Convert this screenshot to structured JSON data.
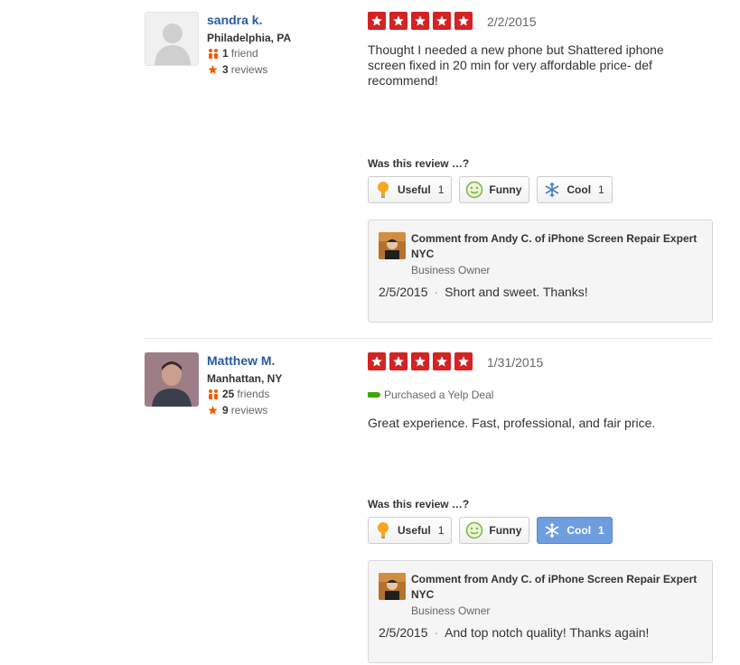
{
  "reviews": [
    {
      "user": {
        "name": "sandra k.",
        "location": "Philadelphia, PA",
        "friends_count": "1",
        "friends_label": "friend",
        "reviews_count": "3",
        "reviews_label": "reviews"
      },
      "rating": 5,
      "date": "2/2/2015",
      "text": "Thought I needed a new phone but Shattered iphone screen fixed in 20 min for very affordable price- def recommend!",
      "was_helpful_label": "Was this review …?",
      "votes": [
        {
          "label": "Useful",
          "count": "1",
          "icon": "lightbulb-icon",
          "active": false
        },
        {
          "label": "Funny",
          "count": "",
          "icon": "smiley-icon",
          "active": false
        },
        {
          "label": "Cool",
          "count": "1",
          "icon": "snowflake-icon",
          "active": false
        }
      ],
      "owner_comment": {
        "title": "Comment from Andy C. of iPhone Screen Repair Expert NYC",
        "role": "Business Owner",
        "date": "2/5/2015",
        "text": "Short and sweet. Thanks!"
      }
    },
    {
      "user": {
        "name": "Matthew M.",
        "location": "Manhattan, NY",
        "friends_count": "25",
        "friends_label": "friends",
        "reviews_count": "9",
        "reviews_label": "reviews"
      },
      "rating": 5,
      "date": "1/31/2015",
      "deal_label": "Purchased a Yelp Deal",
      "text": "Great experience.  Fast, professional, and fair price.",
      "was_helpful_label": "Was this review …?",
      "votes": [
        {
          "label": "Useful",
          "count": "1",
          "icon": "lightbulb-icon",
          "active": false
        },
        {
          "label": "Funny",
          "count": "",
          "icon": "smiley-icon",
          "active": false
        },
        {
          "label": "Cool",
          "count": "1",
          "icon": "snowflake-icon",
          "active": true
        }
      ],
      "owner_comment": {
        "title": "Comment from Andy C. of iPhone Screen Repair Expert NYC",
        "role": "Business Owner",
        "date": "2/5/2015",
        "text": "And top notch quality! Thanks again!"
      }
    }
  ],
  "colors": {
    "star_red": "#d32323",
    "link_blue": "#2a5a9c",
    "cool_active": "#6f9ee0",
    "deal_green": "#41a700"
  }
}
